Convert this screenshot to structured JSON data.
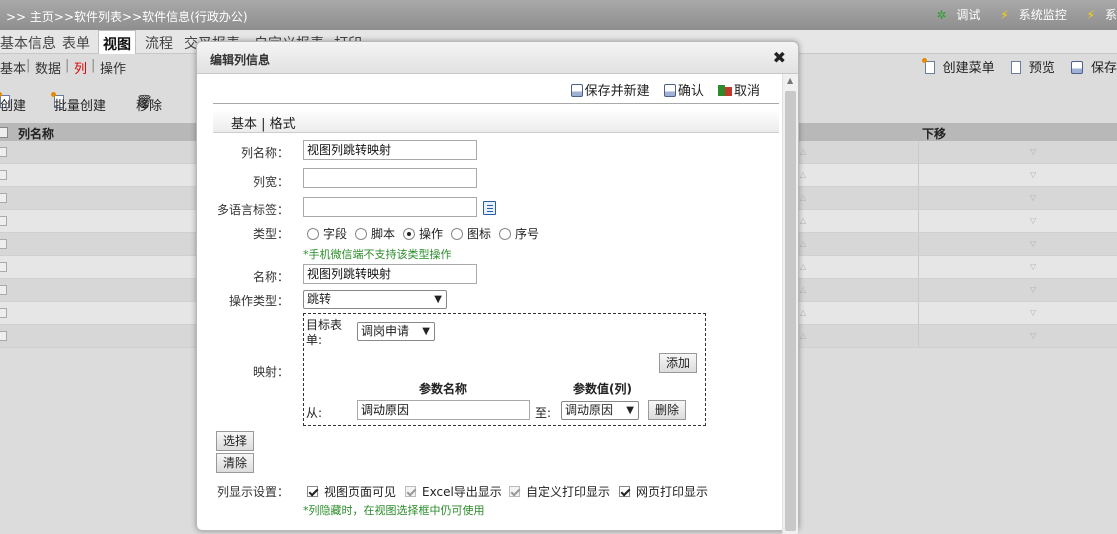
{
  "topbar": {
    "breadcrumb": ">> 主页>>软件列表>>软件信息(行政办公)",
    "debug": "调试",
    "monitor": "系统监控",
    "trailing": "系"
  },
  "tabs": [
    "基本信息",
    "表单",
    "视图",
    "流程",
    "交叉报表",
    "自定义报表",
    "打印"
  ],
  "subtabs": {
    "basic": "基本",
    "data": "数据",
    "column": "列",
    "operation": "操作"
  },
  "right_tools": {
    "create_menu": "创建菜单",
    "preview": "预览",
    "save": "保存"
  },
  "actions": {
    "create": "创建",
    "batch_create": "批量创建",
    "remove": "移除"
  },
  "grid": {
    "col_name": "列名称",
    "move_down": "下移"
  },
  "dialog": {
    "title": "编辑列信息",
    "toolbar": {
      "save_new": "保存并新建",
      "confirm": "确认",
      "cancel": "取消"
    },
    "subtab": "基本 | 格式",
    "fields": {
      "col_name_label": "列名称：",
      "col_name_value": "视图列跳转映射",
      "col_width_label": "列宽：",
      "col_width_value": "",
      "i18n_label": "多语言标签：",
      "i18n_value": "",
      "type_label": "类型：",
      "type_options": [
        "字段",
        "脚本",
        "操作",
        "图标",
        "序号"
      ],
      "type_hint": "*手机微信端不支持该类型操作",
      "name_label": "名称：",
      "name_value": "视图列跳转映射",
      "op_type_label": "操作类型：",
      "op_type_value": "跳转",
      "mapping_label": "映射：",
      "target_form_label": "目标表单:",
      "target_form_value": "调岗申请",
      "add_button": "添加",
      "param_name_header": "参数名称",
      "param_value_header": "参数值(列)",
      "from_label": "从:",
      "from_value": "调动原因",
      "to_label": "至:",
      "to_value": "调动原因",
      "delete_button": "删除",
      "select_button": "选择",
      "clear_button": "清除",
      "display_label": "列显示设置：",
      "display_options": [
        "视图页面可见",
        "Excel导出显示",
        "自定义打印显示",
        "网页打印显示"
      ],
      "display_hint": "*列隐藏时，在视图选择框中仍可使用"
    }
  }
}
